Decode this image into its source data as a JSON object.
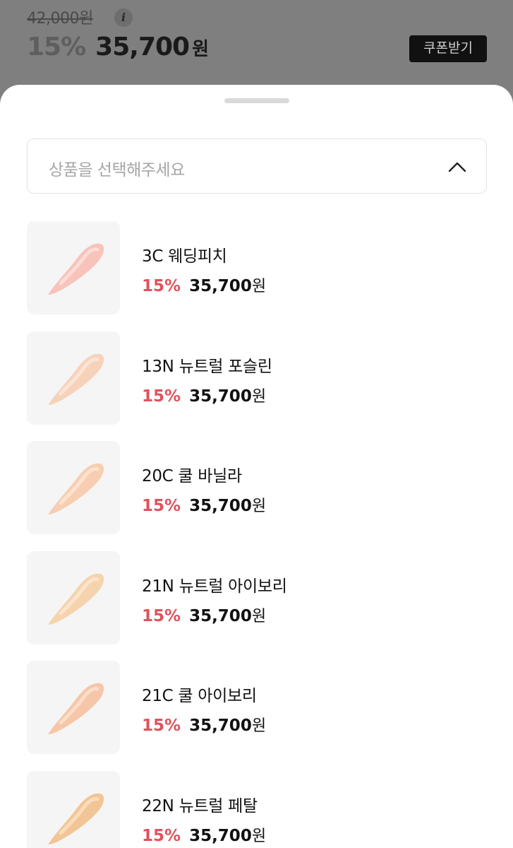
{
  "product": {
    "original_price": "42,000원",
    "info_icon": "info-icon",
    "discount_rate": "15%",
    "sale_price": "35,700",
    "currency_unit": "원",
    "coupon_button_label": "쿠폰받기"
  },
  "selector": {
    "placeholder": "상품을 선택해주세요",
    "toggle_icon": "chevron-up-icon"
  },
  "colors": {
    "discount_red": "#e0525c",
    "coupon_button_bg": "#111111"
  },
  "options": [
    {
      "name": "3C 웨딩피치",
      "discount": "15%",
      "price": "35,700",
      "unit": "원",
      "swatch_color": "#f7c3ba",
      "swatch_highlight": "#fde2dc"
    },
    {
      "name": "13N 뉴트럴 포슬린",
      "discount": "15%",
      "price": "35,700",
      "unit": "원",
      "swatch_color": "#f6d2bb",
      "swatch_highlight": "#fde9dc"
    },
    {
      "name": "20C 쿨 바닐라",
      "discount": "15%",
      "price": "35,700",
      "unit": "원",
      "swatch_color": "#f7ceb2",
      "swatch_highlight": "#fde7d6"
    },
    {
      "name": "21N 뉴트럴 아이보리",
      "discount": "15%",
      "price": "35,700",
      "unit": "원",
      "swatch_color": "#f5d3ad",
      "swatch_highlight": "#fce9d2"
    },
    {
      "name": "21C 쿨 아이보리",
      "discount": "15%",
      "price": "35,700",
      "unit": "원",
      "swatch_color": "#f5c6a8",
      "swatch_highlight": "#fce2cf"
    },
    {
      "name": "22N 뉴트럴 페탈",
      "discount": "15%",
      "price": "35,700",
      "unit": "원",
      "swatch_color": "#f2c596",
      "swatch_highlight": "#fbe1c4"
    }
  ]
}
